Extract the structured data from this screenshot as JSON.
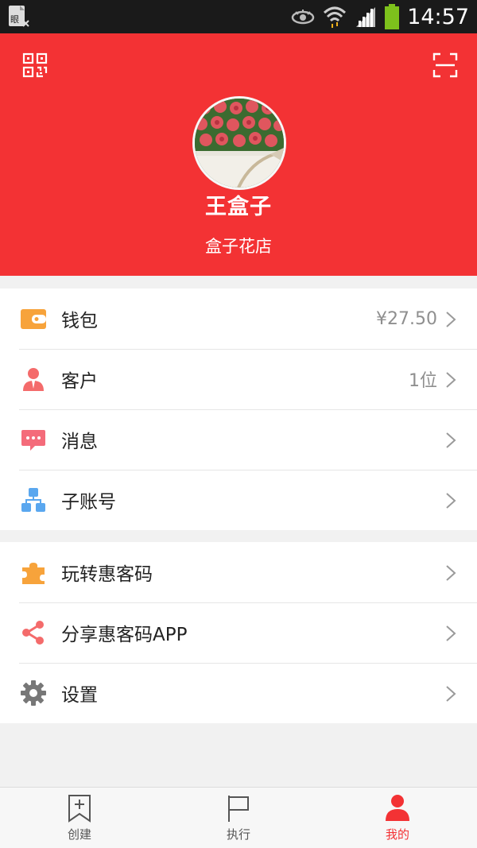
{
  "status_bar": {
    "time": "14:57",
    "icons": [
      "eye-icon",
      "wifi-icon",
      "signal-icon",
      "battery-icon"
    ]
  },
  "header": {
    "left_icon": "qr-code-icon",
    "right_icon": "scan-icon",
    "avatar": "avatar-roses",
    "user_name": "王盒子",
    "shop_name": "盒子花店",
    "background_color": "#f33234"
  },
  "menu_group_1": [
    {
      "icon": "wallet-icon",
      "label": "钱包",
      "value": "¥27.50",
      "icon_color": "#f7a33b"
    },
    {
      "icon": "customer-icon",
      "label": "客户",
      "value": "1位",
      "icon_color": "#f46b6b"
    },
    {
      "icon": "message-icon",
      "label": "消息",
      "value": "",
      "icon_color": "#f46b7a"
    },
    {
      "icon": "sub-account-icon",
      "label": "子账号",
      "value": "",
      "icon_color": "#5aa7ef"
    }
  ],
  "menu_group_2": [
    {
      "icon": "puzzle-icon",
      "label": "玩转惠客码",
      "value": "",
      "icon_color": "#f7a33b"
    },
    {
      "icon": "share-icon",
      "label": "分享惠客码APP",
      "value": "",
      "icon_color": "#f46b6b"
    },
    {
      "icon": "gear-icon",
      "label": "设置",
      "value": "",
      "icon_color": "#777777"
    }
  ],
  "tab_bar": [
    {
      "icon": "create-bookmark-icon",
      "label": "创建",
      "active": false
    },
    {
      "icon": "flag-icon",
      "label": "执行",
      "active": false
    },
    {
      "icon": "person-icon",
      "label": "我的",
      "active": true
    }
  ],
  "accent_color": "#f33234"
}
